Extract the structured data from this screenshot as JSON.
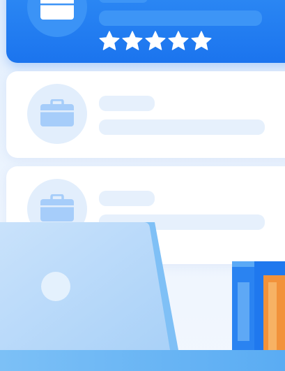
{
  "featured_card": {
    "icon": "briefcase-icon",
    "rating": {
      "value": 5,
      "max": 5
    }
  },
  "placeholder_cards": [
    {
      "icon": "briefcase-icon"
    },
    {
      "icon": "briefcase-icon"
    }
  ],
  "illustration": {
    "laptop": "laptop-illustration",
    "books": "books-illustration",
    "desk": "desk-surface"
  },
  "colors": {
    "accent": "#1b74ee",
    "accent_light": "#3d95f6",
    "placeholder": "#e6f0fc",
    "icon_light": "#a6cdfa",
    "background": "#eaf3fe",
    "star": "#ffffff",
    "book_orange": "#f2923a"
  }
}
